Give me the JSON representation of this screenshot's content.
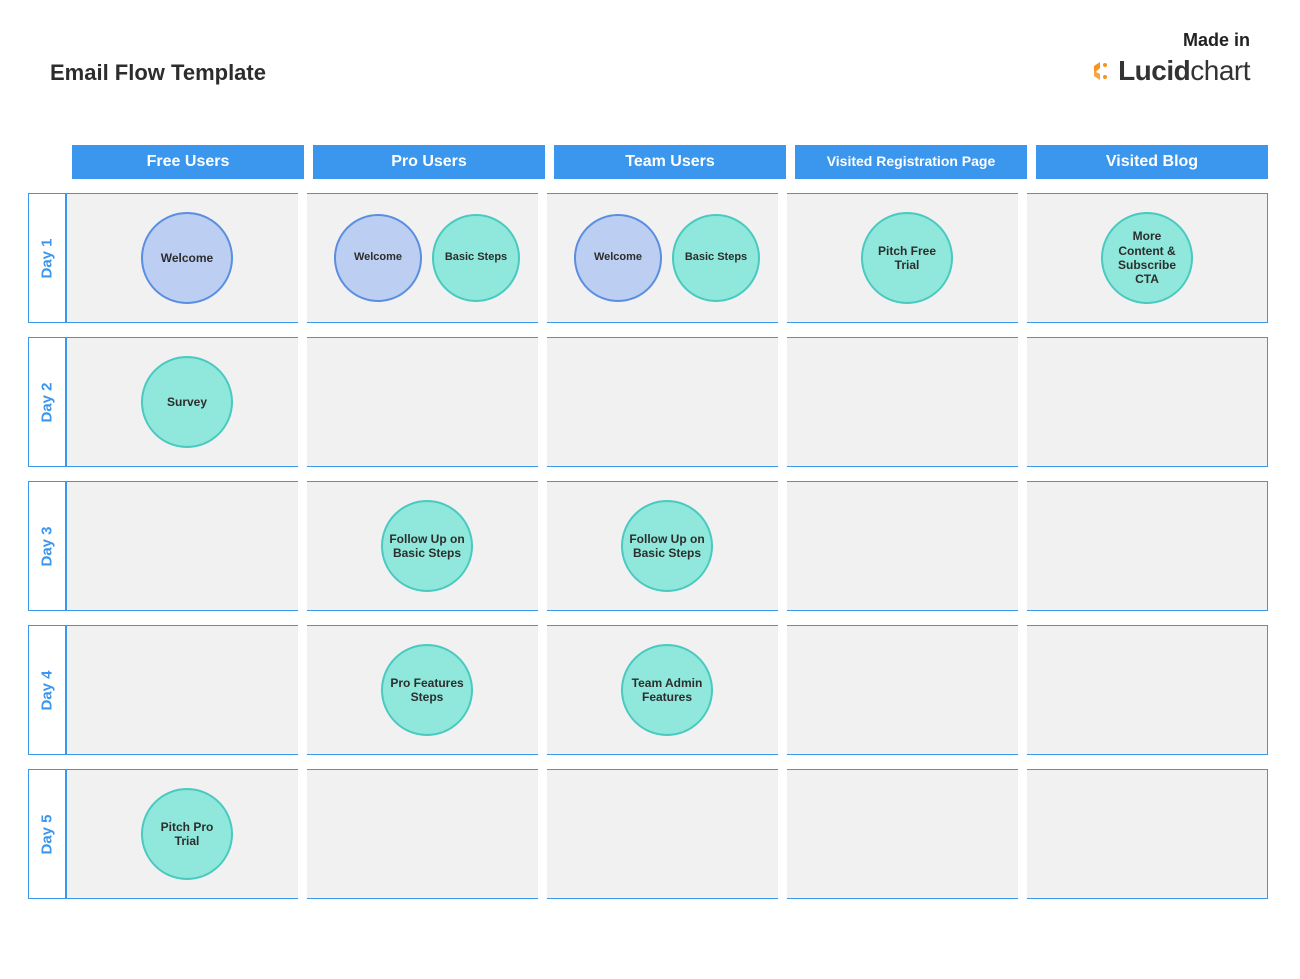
{
  "title": "Email Flow Template",
  "madeIn": "Made in",
  "logoText1": "Lucid",
  "logoText2": "chart",
  "columns": [
    {
      "label": "Free Users"
    },
    {
      "label": "Pro Users"
    },
    {
      "label": "Team Users"
    },
    {
      "label": "Visited  Registration Page",
      "small": true
    },
    {
      "label": "Visited Blog"
    }
  ],
  "rows": [
    {
      "label": "Day 1",
      "cells": [
        [
          {
            "text": "Welcome",
            "color": "blue"
          }
        ],
        [
          {
            "text": "Welcome",
            "color": "blue"
          },
          {
            "text": "Basic Steps",
            "color": "teal"
          }
        ],
        [
          {
            "text": "Welcome",
            "color": "blue"
          },
          {
            "text": "Basic Steps",
            "color": "teal"
          }
        ],
        [
          {
            "text": "Pitch Free Trial",
            "color": "teal"
          }
        ],
        [
          {
            "text": "More Content & Subscribe CTA",
            "color": "teal"
          }
        ]
      ]
    },
    {
      "label": "Day 2",
      "cells": [
        [
          {
            "text": "Survey",
            "color": "teal"
          }
        ],
        [],
        [],
        [],
        []
      ]
    },
    {
      "label": "Day 3",
      "cells": [
        [],
        [
          {
            "text": "Follow Up on Basic Steps",
            "color": "teal"
          }
        ],
        [
          {
            "text": "Follow Up on Basic Steps",
            "color": "teal"
          }
        ],
        [],
        []
      ]
    },
    {
      "label": "Day 4",
      "cells": [
        [],
        [
          {
            "text": "Pro Features Steps",
            "color": "teal"
          }
        ],
        [
          {
            "text": "Team Admin Features",
            "color": "teal"
          }
        ],
        [],
        []
      ]
    },
    {
      "label": "Day 5",
      "cells": [
        [
          {
            "text": "Pitch Pro Trial",
            "color": "teal"
          }
        ],
        [],
        [],
        [],
        []
      ]
    }
  ]
}
